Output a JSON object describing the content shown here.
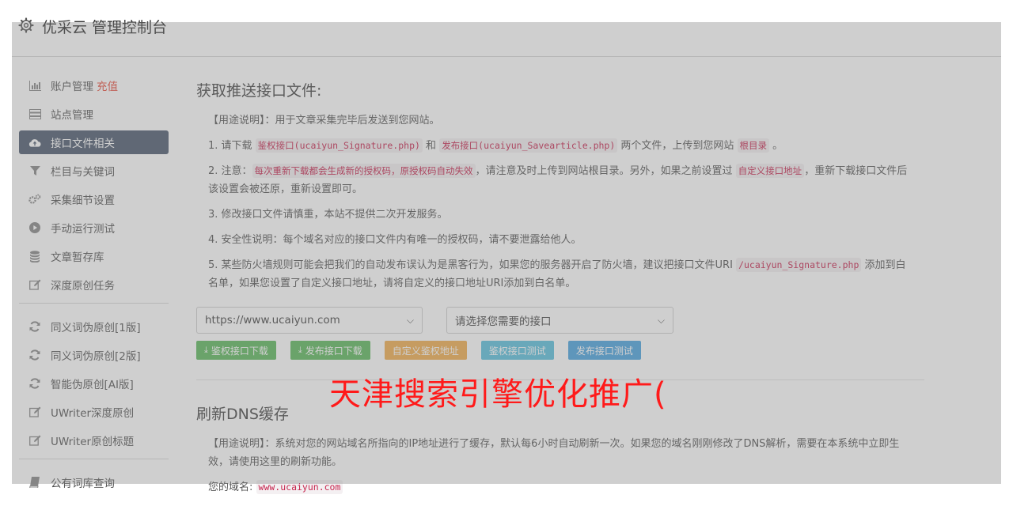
{
  "header": {
    "title": "优采云 管理控制台"
  },
  "sidebar": {
    "group1": [
      {
        "label": "账户管理",
        "extra": "充值",
        "icon": "bar-chart-icon"
      },
      {
        "label": "站点管理",
        "icon": "server-icon"
      },
      {
        "label": "接口文件相关",
        "icon": "cloud-upload-icon",
        "active": true
      },
      {
        "label": "栏目与关键词",
        "icon": "filter-icon"
      },
      {
        "label": "采集细节设置",
        "icon": "cogs-icon"
      },
      {
        "label": "手动运行测试",
        "icon": "play-circle-icon"
      },
      {
        "label": "文章暂存库",
        "icon": "database-icon"
      },
      {
        "label": "深度原创任务",
        "icon": "edit-icon"
      }
    ],
    "group2": [
      {
        "label": "同义词伪原创[1版]",
        "icon": "refresh-icon"
      },
      {
        "label": "同义词伪原创[2版]",
        "icon": "refresh-icon"
      },
      {
        "label": "智能伪原创[AI版]",
        "icon": "refresh-icon"
      },
      {
        "label": "UWriter深度原创",
        "icon": "edit-icon"
      },
      {
        "label": "UWriter原创标题",
        "icon": "edit-icon"
      }
    ],
    "group3": [
      {
        "label": "公有词库查询",
        "icon": "book-icon"
      }
    ]
  },
  "section1": {
    "title": "获取推送接口文件:",
    "usage": "【用途说明】：用于文章采集完毕后发送到您网站。",
    "p1_a": "1. 请下载 ",
    "p1_code1": "鉴权接口(ucaiyun_Signature.php)",
    "p1_b": " 和 ",
    "p1_code2": "发布接口(ucaiyun_Savearticle.php)",
    "p1_c": " 两个文件，上传到您网站 ",
    "p1_code3": "根目录",
    "p1_d": " 。",
    "p2_a": "2. 注意：",
    "p2_code1": "每次重新下载都会生成新的授权码，原授权码自动失效",
    "p2_b": "，请注意及时上传到网站根目录。另外，如果之前设置过 ",
    "p2_code2": "自定义接口地址",
    "p2_c": "，重新下载接口文件后该设置会被还原，重新设置即可。",
    "p3": "3. 修改接口文件请慎重，本站不提供二次开发服务。",
    "p4": "4. 安全性说明：每个域名对应的接口文件内有唯一的授权码，请不要泄露给他人。",
    "p5_a": "5. 某些防火墙规则可能会把我们的自动发布误认为是黑客行为，如果您的服务器开启了防火墙，建议把接口文件URI ",
    "p5_code": "/ucaiyun_Signature.php",
    "p5_b": " 添加到白名单，如果您设置了自定义接口地址，请将自定义的接口地址URI添加到白名单。",
    "site_select": "https://www.ucaiyun.com",
    "api_select": "请选择您需要的接口",
    "buttons": {
      "download_auth": "鉴权接口下载",
      "download_publish": "发布接口下载",
      "custom_auth": "自定义鉴权地址",
      "test_auth": "鉴权接口测试",
      "test_publish": "发布接口测试"
    }
  },
  "watermark": "天津搜索引擎优化推广(",
  "section2": {
    "title": "刷新DNS缓存",
    "usage": "【用途说明】：系统对您的网站域名所指向的IP地址进行了缓存，默认每6小时自动刷新一次。如果您的域名刚刚修改了DNS解析，需要在本系统中立即生效，请使用这里的刷新功能。",
    "domain_label": "您的域名:",
    "domain_value": "www.ucaiyun.com"
  }
}
